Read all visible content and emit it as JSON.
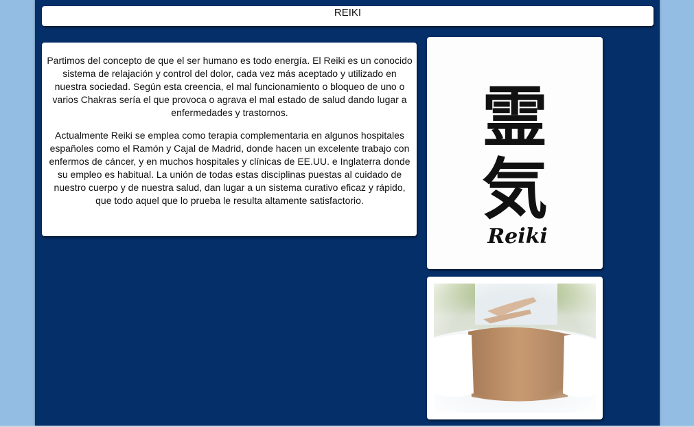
{
  "header": {
    "title": "REIKI"
  },
  "content": {
    "paragraphs": [
      "Partimos del concepto de que el ser humano es todo energía. El Reiki es un conocido sistema de relajación y control del dolor, cada vez más aceptado y utilizado en nuestra sociedad. Según esta creencia, el mal funcionamiento o bloqueo de uno o varios Chakras sería el que provoca o agrava el mal estado de salud dando lugar a enfermedades y trastornos.",
      "Actualmente Reiki se emplea como terapia complementaria en algunos hospitales españoles como el Ramón y Cajal de Madrid, donde hacen un excelente trabajo con enfermos de cáncer, y en muchos hospitales y clínicas de EE.UU. e Inglaterra donde su empleo es habitual. La unión de todas estas disciplinas puestas al cuidado de nuestro cuerpo y de nuestra salud, dan lugar a un sistema curativo eficaz y rápido, que todo aquel que lo prueba le resulta altamente satisfactorio."
    ]
  },
  "images": {
    "kanji": {
      "characters": "霊気",
      "caption": "Reiki"
    },
    "photo": {
      "icon": "reiki-hands-photo"
    }
  },
  "colors": {
    "background": "#93bde2",
    "page": "#052f68",
    "box": "#ffffff"
  }
}
